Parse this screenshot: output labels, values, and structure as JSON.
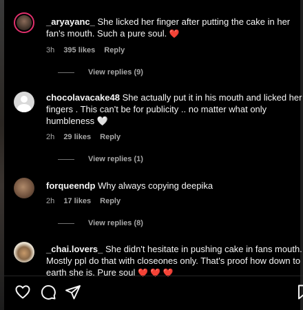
{
  "comments": [
    {
      "username": "_aryayanc_",
      "text": "She licked her finger after putting the cake in her fan's mouth. Such a pure soul.",
      "emoji": "❤️",
      "time": "3h",
      "likes": "395 likes",
      "reply": "Reply",
      "view_replies": "View replies (9)"
    },
    {
      "username": "chocolavacake48",
      "text": "She actually put it in his mouth and licked her fingers . This can't be for publicity .. no matter what only humbleness",
      "emoji": "🤍",
      "time": "2h",
      "likes": "29 likes",
      "reply": "Reply",
      "view_replies": "View replies (1)"
    },
    {
      "username": "forqueendp",
      "text": "Why always copying deepika",
      "time": "2h",
      "likes": "17 likes",
      "reply": "Reply",
      "view_replies": "View replies (8)"
    },
    {
      "username": "_chai.lovers_",
      "text": "She didn't hesitate in pushing cake in fans mouth. Mostly ppl do that with closeones only. That's proof how down to earth she is. Pure soul",
      "emoji": "❤️ ❤️ ❤️"
    }
  ],
  "actions": {
    "like_icon": "heart-outline-icon",
    "comment_icon": "comment-bubble-icon",
    "share_icon": "paper-plane-icon",
    "save_icon": "bookmark-icon"
  },
  "colors": {
    "background": "#000000",
    "text": "#f5f5f5",
    "muted": "#a8a8a8",
    "heart": "#ff3040"
  }
}
